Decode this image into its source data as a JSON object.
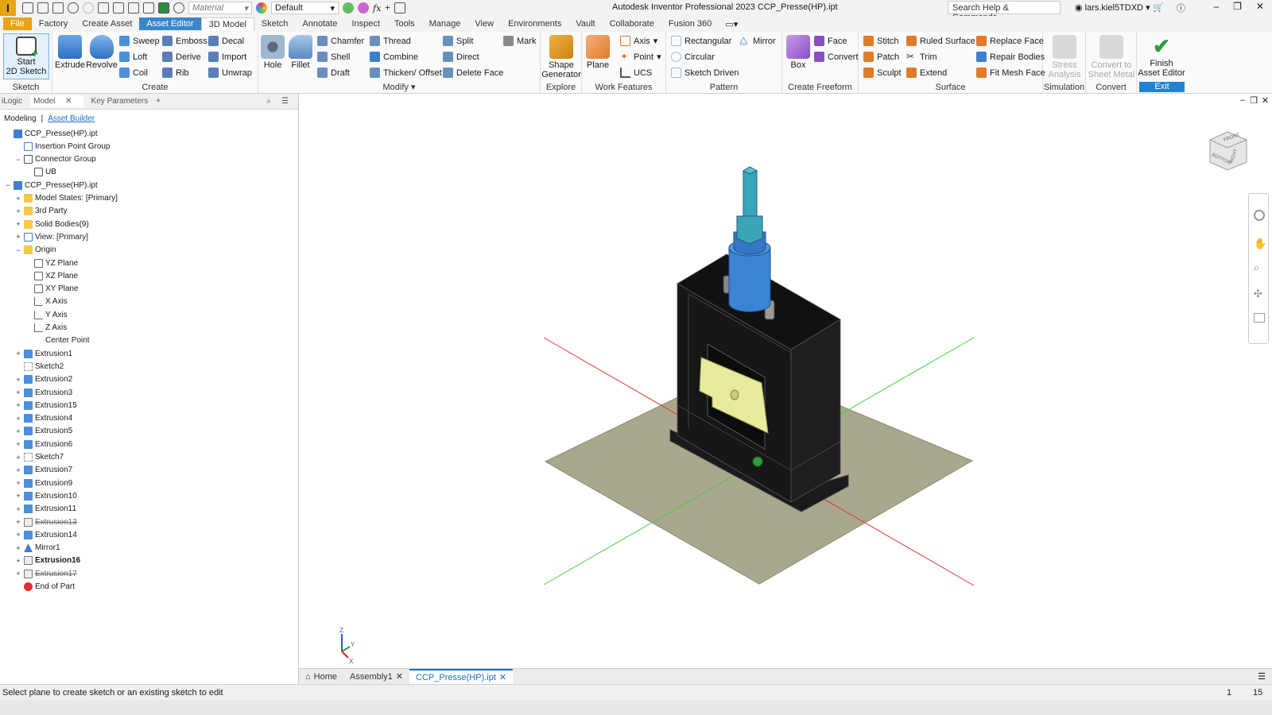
{
  "app": {
    "logo": "I",
    "title": "Autodesk Inventor Professional 2023   CCP_Presse(HP).ipt",
    "search_placeholder": "Search Help & Commands...",
    "user": "lars.kiel5TDXD"
  },
  "qat": {
    "material": "Material",
    "appearance": "Default"
  },
  "menu_tabs": [
    "File",
    "Factory",
    "Create Asset",
    "Asset Editor",
    "3D Model",
    "Sketch",
    "Annotate",
    "Inspect",
    "Tools",
    "Manage",
    "View",
    "Environments",
    "Vault",
    "Collaborate",
    "Fusion 360"
  ],
  "ribbon": {
    "sketch": {
      "start_sketch": "Start\n2D Sketch",
      "label": "Sketch"
    },
    "create": {
      "extrude": "Extrude",
      "revolve": "Revolve",
      "sweep": "Sweep",
      "loft": "Loft",
      "coil": "Coil",
      "emboss": "Emboss",
      "derive": "Derive",
      "rib": "Rib",
      "decal": "Decal",
      "import": "Import",
      "unwrap": "Unwrap",
      "label": "Create"
    },
    "modify": {
      "hole": "Hole",
      "fillet": "Fillet",
      "chamfer": "Chamfer",
      "shell": "Shell",
      "draft": "Draft",
      "thread": "Thread",
      "combine": "Combine",
      "thicken": "Thicken/ Offset",
      "split": "Split",
      "direct": "Direct",
      "delete_face": "Delete Face",
      "mark": "Mark",
      "label": "Modify"
    },
    "explore": {
      "shape_generator": "Shape\nGenerator",
      "label": "Explore"
    },
    "work": {
      "plane": "Plane",
      "axis": "Axis",
      "point": "Point",
      "ucs": "UCS",
      "label": "Work Features"
    },
    "pattern": {
      "rectangular": "Rectangular",
      "circular": "Circular",
      "sketch_driven": "Sketch Driven",
      "mirror": "Mirror",
      "label": "Pattern"
    },
    "freeform": {
      "box": "Box",
      "face": "Face",
      "convert": "Convert",
      "label": "Create Freeform"
    },
    "surface": {
      "stitch": "Stitch",
      "patch": "Patch",
      "sculpt": "Sculpt",
      "ruled": "Ruled Surface",
      "trim": "Trim",
      "extend": "Extend",
      "replace_face": "Replace Face",
      "repair": "Repair Bodies",
      "fit_mesh": "Fit Mesh Face",
      "label": "Surface"
    },
    "simulation": {
      "stress": "Stress\nAnalysis",
      "label": "Simulation"
    },
    "convert": {
      "sheet_metal": "Convert to\nSheet Metal",
      "label": "Convert"
    },
    "exit": {
      "finish": "Finish\nAsset Editor",
      "label": "Exit"
    }
  },
  "browser": {
    "tabs": [
      "iLogic",
      "Model",
      "Key Parameters"
    ],
    "modes": [
      "Modeling",
      "Asset Builder"
    ],
    "tree": [
      {
        "label": "CCP_Presse(HP).ipt",
        "indent": 0,
        "icon": "part",
        "tw": ""
      },
      {
        "label": "Insertion Point Group",
        "indent": 1,
        "icon": "ipoint",
        "tw": ""
      },
      {
        "label": "Connector Group",
        "indent": 1,
        "icon": "connector",
        "tw": "−"
      },
      {
        "label": "UB",
        "indent": 2,
        "icon": "connector",
        "tw": ""
      },
      {
        "label": "CCP_Presse(HP).ipt",
        "indent": 0,
        "icon": "part",
        "tw": "−"
      },
      {
        "label": "Model States: [Primary]",
        "indent": 1,
        "icon": "folder",
        "tw": "+"
      },
      {
        "label": "3rd Party",
        "indent": 1,
        "icon": "folder",
        "tw": "+"
      },
      {
        "label": "Solid Bodies(9)",
        "indent": 1,
        "icon": "folder",
        "tw": "+"
      },
      {
        "label": "View: [Primary]",
        "indent": 1,
        "icon": "view",
        "tw": "+"
      },
      {
        "label": "Origin",
        "indent": 1,
        "icon": "folder",
        "tw": "−"
      },
      {
        "label": "YZ Plane",
        "indent": 2,
        "icon": "plane",
        "tw": ""
      },
      {
        "label": "XZ Plane",
        "indent": 2,
        "icon": "plane",
        "tw": ""
      },
      {
        "label": "XY Plane",
        "indent": 2,
        "icon": "plane",
        "tw": ""
      },
      {
        "label": "X Axis",
        "indent": 2,
        "icon": "axis",
        "tw": ""
      },
      {
        "label": "Y Axis",
        "indent": 2,
        "icon": "axis",
        "tw": ""
      },
      {
        "label": "Z Axis",
        "indent": 2,
        "icon": "axis",
        "tw": ""
      },
      {
        "label": "Center Point",
        "indent": 2,
        "icon": "point",
        "tw": ""
      },
      {
        "label": "Extrusion1",
        "indent": 1,
        "icon": "extrude",
        "tw": "+"
      },
      {
        "label": "Sketch2",
        "indent": 1,
        "icon": "sketch",
        "tw": ""
      },
      {
        "label": "Extrusion2",
        "indent": 1,
        "icon": "extrude",
        "tw": "+"
      },
      {
        "label": "Extrusion3",
        "indent": 1,
        "icon": "extrude",
        "tw": "+"
      },
      {
        "label": "Extrusion15",
        "indent": 1,
        "icon": "extrude",
        "tw": "+"
      },
      {
        "label": "Extrusion4",
        "indent": 1,
        "icon": "extrude",
        "tw": "+"
      },
      {
        "label": "Extrusion5",
        "indent": 1,
        "icon": "extrude",
        "tw": "+"
      },
      {
        "label": "Extrusion6",
        "indent": 1,
        "icon": "extrude",
        "tw": "+"
      },
      {
        "label": "Sketch7",
        "indent": 1,
        "icon": "sketch",
        "tw": "+"
      },
      {
        "label": "Extrusion7",
        "indent": 1,
        "icon": "extrude",
        "tw": "+"
      },
      {
        "label": "Extrusion9",
        "indent": 1,
        "icon": "extrude",
        "tw": "+"
      },
      {
        "label": "Extrusion10",
        "indent": 1,
        "icon": "extrude",
        "tw": "+"
      },
      {
        "label": "Extrusion11",
        "indent": 1,
        "icon": "extrude",
        "tw": "+"
      },
      {
        "label": "Extrusion13",
        "indent": 1,
        "icon": "suppressed",
        "tw": "+",
        "style": "strike"
      },
      {
        "label": "Extrusion14",
        "indent": 1,
        "icon": "extrude",
        "tw": "+"
      },
      {
        "label": "Mirror1",
        "indent": 1,
        "icon": "mirror",
        "tw": "+"
      },
      {
        "label": "Extrusion16",
        "indent": 1,
        "icon": "suppressed",
        "tw": "+",
        "style": "bold"
      },
      {
        "label": "Extrusion17",
        "indent": 1,
        "icon": "suppressed",
        "tw": "+",
        "style": "strike"
      },
      {
        "label": "End of Part",
        "indent": 1,
        "icon": "eop",
        "tw": ""
      }
    ]
  },
  "viewcube": {
    "front": "FRONT",
    "right": "RIGHT",
    "bottom": "BOTTOM"
  },
  "triad": {
    "x": "X",
    "y": "Y",
    "z": "Z"
  },
  "doc_tabs": [
    {
      "label": "Home",
      "close": false
    },
    {
      "label": "Assembly1",
      "close": true
    },
    {
      "label": "CCP_Presse(HP).ipt",
      "close": true,
      "current": true
    }
  ],
  "status": {
    "text": "Select plane to create sketch or an existing sketch to edit",
    "num1": "1",
    "num2": "15"
  },
  "colors": {
    "file_tab": "#e8a317",
    "asset_tab": "#3a86c9",
    "body": "#161616",
    "ground": "#a9a88f",
    "blue": "#3c83d4",
    "teal": "#3aa5b9",
    "highlight": "#e9eb9c",
    "x_axis": "#e23030",
    "y_axis": "#3fcf3f"
  }
}
